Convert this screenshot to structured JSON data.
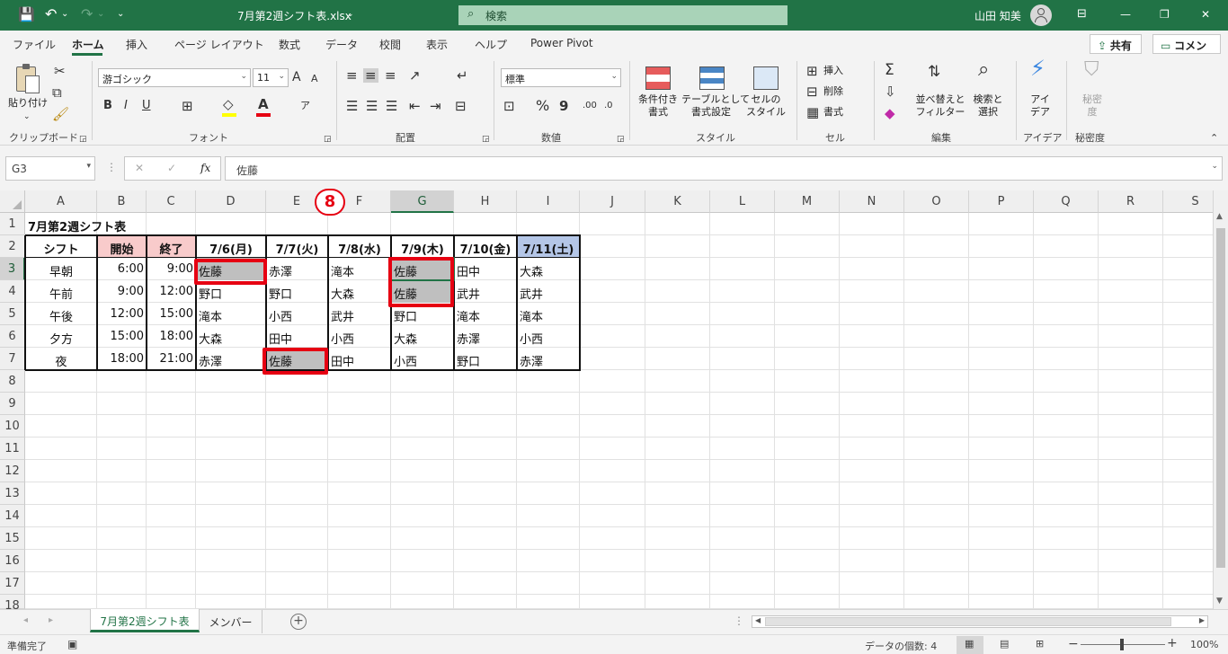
{
  "titlebar": {
    "save": "💾",
    "undo": "↶",
    "undo_caret": "⌄",
    "redo": "↷",
    "redo_caret": "⌄",
    "qat": "⌄",
    "filename": "7月第2週シフト表.xlsx",
    "file_caret": "⌄",
    "search_placeholder": "検索",
    "user": "山田 知美",
    "ribbon_display": "⊟",
    "minimize": "—",
    "restore": "❐",
    "close": "✕"
  },
  "tabs": [
    "ファイル",
    "ホーム",
    "挿入",
    "ページ レイアウト",
    "数式",
    "データ",
    "校閲",
    "表示",
    "ヘルプ",
    "Power Pivot"
  ],
  "share": "共有",
  "comment": "コメント",
  "ribbon": {
    "clipboard": {
      "paste": "貼り付け",
      "label": "クリップボード"
    },
    "font": {
      "name": "游ゴシック",
      "size": "11",
      "label": "フォント",
      "grow": "A",
      "shrink": "A",
      "bold": "B",
      "italic": "I",
      "underline": "U",
      "phonetic": "ア"
    },
    "align": {
      "label": "配置"
    },
    "number": {
      "format": "標準",
      "label": "数値",
      "pct": "%",
      "comma": "9"
    },
    "style": {
      "cond": "条件付き\n書式",
      "table": "テーブルとして\n書式設定",
      "cellstyle": "セルの\nスタイル",
      "label": "スタイル"
    },
    "cells": {
      "insert": "挿入",
      "delete": "削除",
      "format": "書式",
      "label": "セル"
    },
    "edit": {
      "sort": "並べ替えと\nフィルター",
      "find": "検索と\n選択",
      "label": "編集"
    },
    "ideas": {
      "btn": "アイ\nデア",
      "label": "アイデア"
    },
    "sens": {
      "btn": "秘密\n度",
      "label": "秘密度"
    }
  },
  "formula": {
    "namebox": "G3",
    "cancel": "✕",
    "enter": "✓",
    "fx": "fx",
    "value": "佐藤"
  },
  "columns": [
    "A",
    "B",
    "C",
    "D",
    "E",
    "F",
    "G",
    "H",
    "I",
    "J",
    "K",
    "L",
    "M",
    "N",
    "O",
    "P",
    "Q",
    "R",
    "S"
  ],
  "rows": [
    "1",
    "2",
    "3",
    "4",
    "5",
    "6",
    "7",
    "8",
    "9",
    "10",
    "11",
    "12",
    "13",
    "14",
    "15",
    "16",
    "17",
    "18"
  ],
  "sheet": {
    "title": "7月第2週シフト表",
    "headers": [
      "シフト",
      "開始",
      "終了",
      "7/6(月)",
      "7/7(火)",
      "7/8(水)",
      "7/9(木)",
      "7/10(金)",
      "7/11(土)"
    ],
    "body": [
      [
        "早朝",
        "6:00",
        "9:00",
        "佐藤",
        "赤澤",
        "滝本",
        "佐藤",
        "田中",
        "大森"
      ],
      [
        "午前",
        "9:00",
        "12:00",
        "野口",
        "野口",
        "大森",
        "佐藤",
        "武井",
        "武井"
      ],
      [
        "午後",
        "12:00",
        "15:00",
        "滝本",
        "小西",
        "武井",
        "野口",
        "滝本",
        "滝本"
      ],
      [
        "夕方",
        "15:00",
        "18:00",
        "大森",
        "田中",
        "小西",
        "大森",
        "赤澤",
        "小西"
      ],
      [
        "夜",
        "18:00",
        "21:00",
        "赤澤",
        "佐藤",
        "田中",
        "小西",
        "野口",
        "赤澤"
      ]
    ]
  },
  "annotation": "8",
  "sheettabs": [
    "7月第2週シフト表",
    "メンバー"
  ],
  "addsheet": "+",
  "status": {
    "ready": "準備完了",
    "count": "データの個数: 4",
    "zoom": "100%",
    "minus": "−",
    "plus": "+"
  },
  "colors": {
    "accent": "#217346",
    "headerPink": "#f8cbcb",
    "headerBlue": "#b4c6e7",
    "gray": "#bfbfbf",
    "red": "#e60012"
  }
}
